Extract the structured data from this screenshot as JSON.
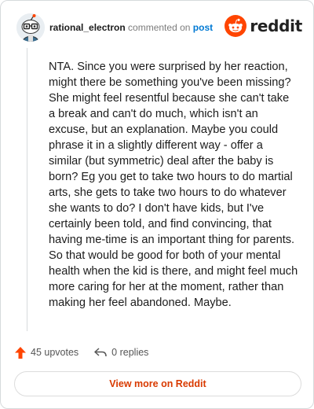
{
  "header": {
    "username": "rational_electron",
    "commented_on": "commented on",
    "post_link": "post",
    "brand": "reddit"
  },
  "comment": {
    "body": "NTA. Since you were surprised by her reaction, might there be something you've been missing? She might feel resentful because she can't take a break and can't do much, which isn't an excuse, but an explanation. Maybe you could phrase it in a slightly different way - offer a similar (but symmetric) deal after the baby is born? Eg you get to take two hours to do martial arts, she gets to take two hours to do whatever she wants to do? I don't have kids, but I've certainly been told, and find convincing, that having me-time is an important thing for parents. So that would be good for both of your mental health when the kid is there, and might feel much more caring for her at the moment, rather than making her feel abandoned. Maybe."
  },
  "actions": {
    "upvotes": "45 upvotes",
    "replies": "0 replies"
  },
  "footer": {
    "view_more": "View more on Reddit"
  },
  "colors": {
    "upvote_orange": "#ff4500",
    "link_blue": "#0079d3",
    "view_more_text": "#d93a00"
  },
  "icons": {
    "avatar": "snoo-avatar-icon",
    "logo": "reddit-logo-icon",
    "upvote": "upvote-arrow-icon",
    "reply": "reply-arrow-icon"
  }
}
